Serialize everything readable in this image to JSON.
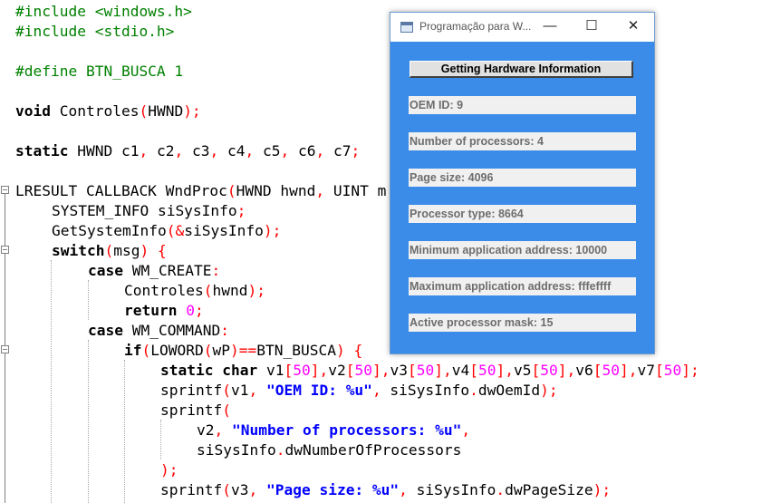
{
  "editor": {
    "lines": {
      "l1": {
        "a": "#include <windows.h>"
      },
      "l2": {
        "a": "#include <stdio.h>"
      },
      "l3": {
        "a": "#define BTN_BUSCA 1"
      },
      "l4": {
        "a": "void",
        "b": " Controles",
        "c": "(",
        "d": "HWND",
        "e": ");"
      },
      "l5": {
        "a": "static",
        "b": " HWND c1",
        "c": ",",
        "d": " c2",
        "e": ",",
        "f": " c3",
        "g": ",",
        "h": " c4",
        "i": ",",
        "j": " c5",
        "k": ",",
        "l": " c6",
        "m": ",",
        "n": " c7",
        "o": ";"
      },
      "l6": {
        "a": "LRESULT CALLBACK WndProc",
        "b": "(",
        "c": "HWND hwnd",
        "d": ",",
        "e": " UINT m"
      },
      "l7": {
        "a": "SYSTEM_INFO siSysInfo",
        "b": ";"
      },
      "l8": {
        "a": "GetSystemInfo",
        "b": "(&",
        "c": "siSysInfo",
        "d": ");"
      },
      "l9": {
        "a": "switch",
        "b": "(",
        "c": "msg",
        "d": ") {"
      },
      "l10": {
        "a": "case",
        "b": " WM_CREATE",
        "c": ":"
      },
      "l11": {
        "a": "Controles",
        "b": "(",
        "c": "hwnd",
        "d": ");"
      },
      "l12": {
        "a": "return",
        "b": " 0",
        "c": ";"
      },
      "l13": {
        "a": "case",
        "b": " WM_COMMAND",
        "c": ":"
      },
      "l14": {
        "a": "if",
        "b": "(",
        "c": "LOWORD",
        "d": "(",
        "e": "wP",
        "f": ")==",
        "g": "BTN_BUSCA",
        "h": ") {"
      },
      "l15": {
        "a": "static",
        "b": " char",
        "c": " v1",
        "d": "[",
        "e": "50",
        "f": "],",
        "g": "v2",
        "h": "[",
        "i": "50",
        "j": "],",
        "k": "v3",
        "l": "[",
        "m": "50",
        "n": "],",
        "o": "v4",
        "p": "[",
        "q": "50",
        "r": "],",
        "s": "v5",
        "t": "[",
        "u": "50",
        "v": "],",
        "w": "v6",
        "x": "[",
        "y": "50",
        "z": "],",
        "aa": "v7",
        "ab": "[",
        "ac": "50",
        "ad": "];"
      },
      "l16": {
        "a": "sprintf",
        "b": "(",
        "c": "v1",
        "d": ",",
        "e": " \"OEM ID: %u\"",
        "f": ",",
        "g": " siSysInfo",
        "h": ".",
        "i": "dwOemId",
        "j": ");"
      },
      "l17": {
        "a": "sprintf",
        "b": "("
      },
      "l18": {
        "a": "v2",
        "b": ",",
        "c": " \"Number of processors: %u\"",
        "d": ","
      },
      "l19": {
        "a": "siSysInfo",
        "b": ".",
        "c": "dwNumberOfProcessors"
      },
      "l20": {
        "a": ");"
      },
      "l21": {
        "a": "sprintf",
        "b": "(",
        "c": "v3",
        "d": ",",
        "e": " \"Page size: %u\"",
        "f": ",",
        "g": " siSysInfo",
        "h": ".",
        "i": "dwPageSize",
        "j": ");"
      }
    }
  },
  "window": {
    "title": "Programação para W...",
    "minimize": "—",
    "maximize": "☐",
    "close": "✕",
    "button_label": "Getting Hardware Information",
    "fields": [
      "OEM ID: 9",
      "Number of processors: 4",
      "Page size: 4096",
      "Processor type: 8664",
      "Minimum application address: 10000",
      "Maximum application address: fffeffff",
      "Active processor mask: 15"
    ],
    "colors": {
      "client_bg": "#3b8ce9",
      "field_text": "#6d6d6d"
    }
  }
}
